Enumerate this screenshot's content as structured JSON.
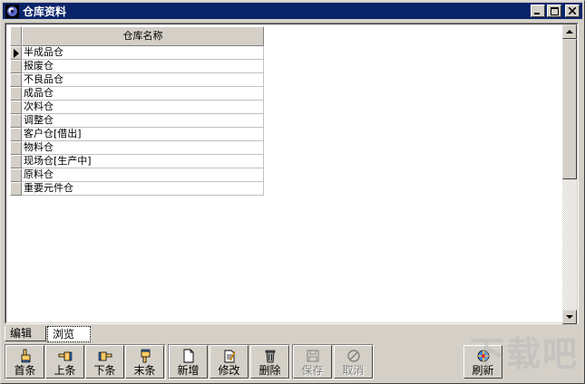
{
  "window": {
    "title": "仓库资料",
    "icon": "app-logo-icon",
    "controls": [
      "minimize-icon",
      "maximize-icon",
      "close-icon"
    ]
  },
  "grid": {
    "column_header": "仓库名称",
    "current_row": 0,
    "rows": [
      "半成品仓",
      "报废仓",
      "不良品仓",
      "成品仓",
      "次料仓",
      "调整仓",
      "客户仓[借出]",
      "物料仓",
      "现场仓[生产中]",
      "原料仓",
      "重要元件仓"
    ]
  },
  "tabs": [
    {
      "label": "编辑",
      "active": false
    },
    {
      "label": "浏览",
      "active": true
    }
  ],
  "toolbar": {
    "first": "首条",
    "prev": "上条",
    "next": "下条",
    "last": "末条",
    "add": "新增",
    "edit": "修改",
    "delete": "删除",
    "save": "保存",
    "cancel": "取消",
    "refresh": "刷新"
  },
  "watermark": "下载吧",
  "colors": {
    "titlebar": "#0a246a",
    "face": "#d4d0c8",
    "disabled_text": "#808080"
  }
}
